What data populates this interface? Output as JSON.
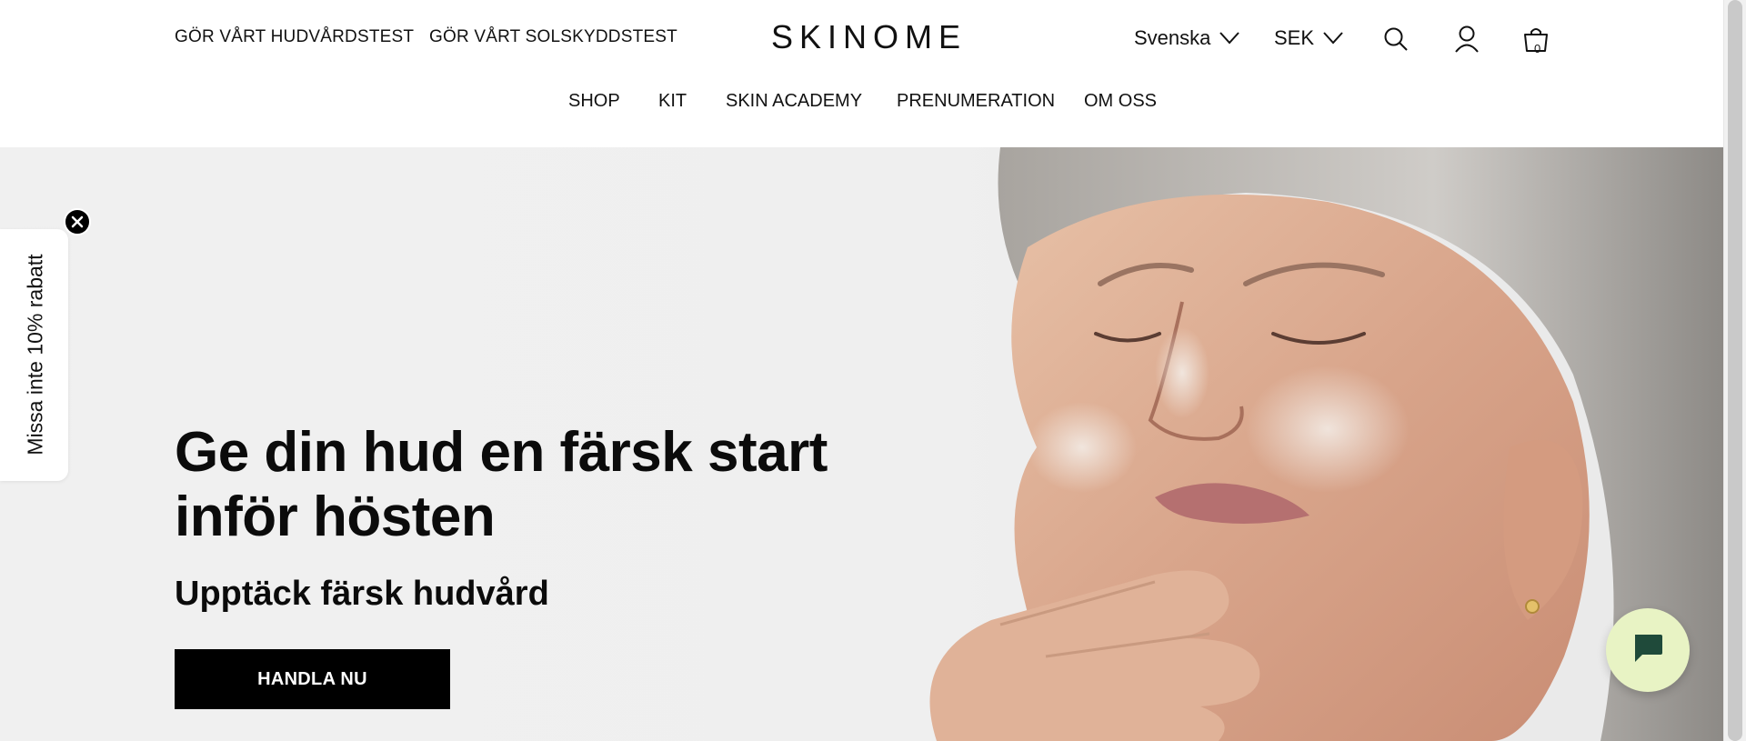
{
  "header": {
    "top_links": [
      "GÖR VÅRT HUDVÅRDSTEST",
      "GÖR VÅRT SOLSKYDDSTEST"
    ],
    "logo": "SKINOME",
    "language": "Svenska",
    "currency": "SEK",
    "cart_count": "0",
    "icons": [
      "search-icon",
      "account-icon",
      "cart-icon",
      "chevron-down-icon"
    ]
  },
  "nav": {
    "items": [
      "SHOP",
      "KIT",
      "SKIN ACADEMY",
      "PRENUMERATION",
      "OM OSS"
    ]
  },
  "hero": {
    "title": "Ge din hud en färsk start inför hösten",
    "subtitle": "Upptäck färsk hudvård",
    "cta_label": "HANDLA NU"
  },
  "discount_tab": {
    "text": "Missa inte 10% rabatt",
    "close_icon": "close-icon"
  },
  "chat": {
    "icon": "chat-bubble-icon",
    "color": "#e8f3c4",
    "icon_color": "#1f4a3a"
  }
}
